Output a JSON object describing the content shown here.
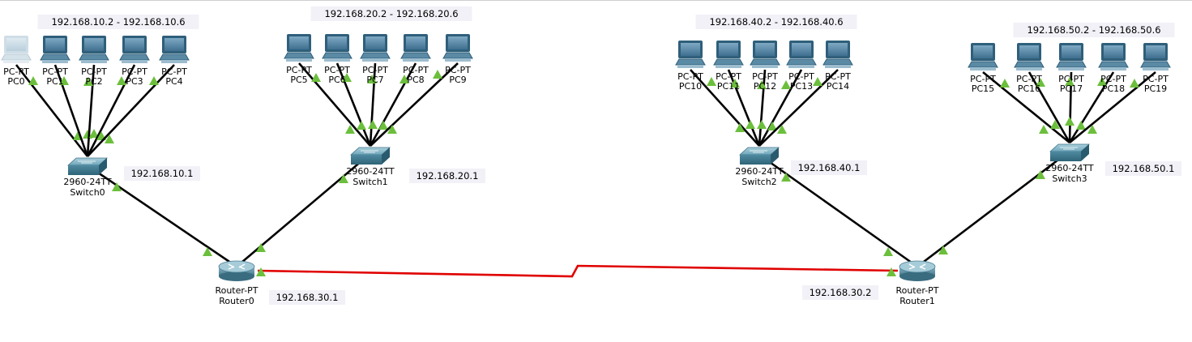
{
  "colors": {
    "background": "#ffffff",
    "link": "#000000",
    "serial_link": "#e00000",
    "link_up": "#6cbf3c",
    "note_bg": "#f1f1f7"
  },
  "pc_model": "PC-PT",
  "switch_model": "2960-24TT",
  "router_model": "Router-PT",
  "switches": [
    {
      "name": "Switch0"
    },
    {
      "name": "Switch1"
    },
    {
      "name": "Switch2"
    },
    {
      "name": "Switch3"
    }
  ],
  "routers": [
    {
      "name": "Router0"
    },
    {
      "name": "Router1"
    }
  ],
  "pcs": [
    {
      "name": "PC0"
    },
    {
      "name": "PC1"
    },
    {
      "name": "PC2"
    },
    {
      "name": "PC3"
    },
    {
      "name": "PC4"
    },
    {
      "name": "PC5"
    },
    {
      "name": "PC6"
    },
    {
      "name": "PC7"
    },
    {
      "name": "PC8"
    },
    {
      "name": "PC9"
    },
    {
      "name": "PC10"
    },
    {
      "name": "PC11"
    },
    {
      "name": "PC12"
    },
    {
      "name": "PC13"
    },
    {
      "name": "PC14"
    },
    {
      "name": "PC15"
    },
    {
      "name": "PC16"
    },
    {
      "name": "PC17"
    },
    {
      "name": "PC18"
    },
    {
      "name": "PC19"
    }
  ],
  "notes": {
    "range_lan10": "192.168.10.2 - 192.168.10.6",
    "range_lan20": "192.168.20.2 - 192.168.20.6",
    "range_lan40": "192.168.40.2 - 192.168.40.6",
    "range_lan50": "192.168.50.2 - 192.168.50.6",
    "gw_lan10": "192.168.10.1",
    "gw_lan20": "192.168.20.1",
    "gw_lan40": "192.168.40.1",
    "gw_lan50": "192.168.50.1",
    "wan_router0": "192.168.30.1",
    "wan_router1": "192.168.30.2"
  }
}
